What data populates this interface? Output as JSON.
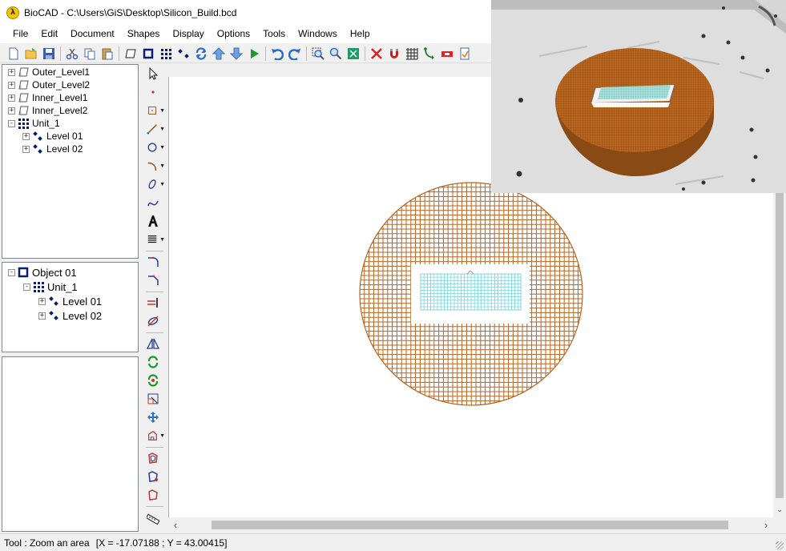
{
  "window": {
    "app_glyph": "λ",
    "title": "BioCAD - C:\\Users\\GiS\\Desktop\\Silicon_Build.bcd"
  },
  "menu": [
    "File",
    "Edit",
    "Document",
    "Shapes",
    "Display",
    "Options",
    "Tools",
    "Windows",
    "Help"
  ],
  "toolbar_icons": [
    "new-icon",
    "open-icon",
    "save-icon",
    "cut-icon",
    "copy-icon",
    "paste-icon",
    "layer-icon",
    "object-icon",
    "unit-icon",
    "level-icon",
    "refresh-icon",
    "move-up-icon",
    "move-down-icon",
    "run-icon",
    "undo-icon",
    "redo-icon",
    "zoom-area-icon",
    "zoom-icon",
    "zoom-fit-icon",
    "delete-icon",
    "magnet-icon",
    "grid-icon",
    "path-icon",
    "ruler-icon",
    "print-icon"
  ],
  "layers_tree": {
    "items": [
      {
        "label": "Outer_Level1",
        "icon": "layer-icon",
        "indent": 0,
        "expander": "+"
      },
      {
        "label": "Outer_Level2",
        "icon": "layer-icon",
        "indent": 0,
        "expander": "+"
      },
      {
        "label": "Inner_Level1",
        "icon": "layer-icon",
        "indent": 0,
        "expander": "+"
      },
      {
        "label": "Inner_Level2",
        "icon": "layer-icon",
        "indent": 0,
        "expander": "+"
      },
      {
        "label": "Unit_1",
        "icon": "unit-icon",
        "indent": 0,
        "expander": "-"
      },
      {
        "label": "Level 01",
        "icon": "level-icon",
        "indent": 1,
        "expander": "+"
      },
      {
        "label": "Level 02",
        "icon": "level-icon",
        "indent": 1,
        "expander": "+"
      }
    ]
  },
  "object_tree": {
    "items": [
      {
        "label": "Object 01",
        "icon": "object-icon",
        "indent": 0,
        "expander": "-"
      },
      {
        "label": "Unit_1",
        "icon": "unit-icon",
        "indent": 1,
        "expander": "-"
      },
      {
        "label": "Level 01",
        "icon": "level-icon",
        "indent": 2,
        "expander": "+"
      },
      {
        "label": "Level 02",
        "icon": "level-icon",
        "indent": 2,
        "expander": "+"
      }
    ]
  },
  "colors": {
    "grid_brown": "#b8651f",
    "grid_cyan": "#7fd4d8",
    "disc_top": "#b8651f",
    "disc_side": "#8a4a14"
  },
  "status": {
    "tool": "Tool : Zoom an area",
    "coords": "[X = -17.07188 ; Y = 43.00415]"
  }
}
